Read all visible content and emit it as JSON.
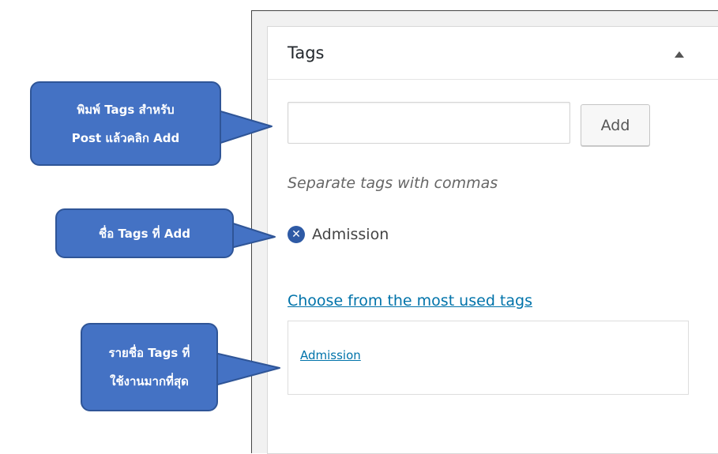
{
  "panel": {
    "title": "Tags",
    "add_label": "Add",
    "input_value": "",
    "hint": "Separate tags with commas",
    "selected_tags": [
      "Admission"
    ],
    "most_used_link": "Choose from the most used tags",
    "tag_cloud": [
      "Admission"
    ],
    "toggle_icon": "triangle-up-icon",
    "remove_icon": "circle-x-icon"
  },
  "callouts": {
    "add_instruction": {
      "line1": "พิมพ์ Tags สำหรับ",
      "line2": "Post แล้วคลิก Add"
    },
    "added_name": {
      "line1": "ชื่อ Tags ที่ Add"
    },
    "most_used": {
      "line1": "รายชื่อ Tags ที่",
      "line2": "ใช้งานมากที่สุด"
    }
  },
  "colors": {
    "callout_fill": "#4472c4",
    "callout_border": "#2f5597",
    "link": "#0073aa",
    "remove_icon": "#2e5aa5"
  }
}
